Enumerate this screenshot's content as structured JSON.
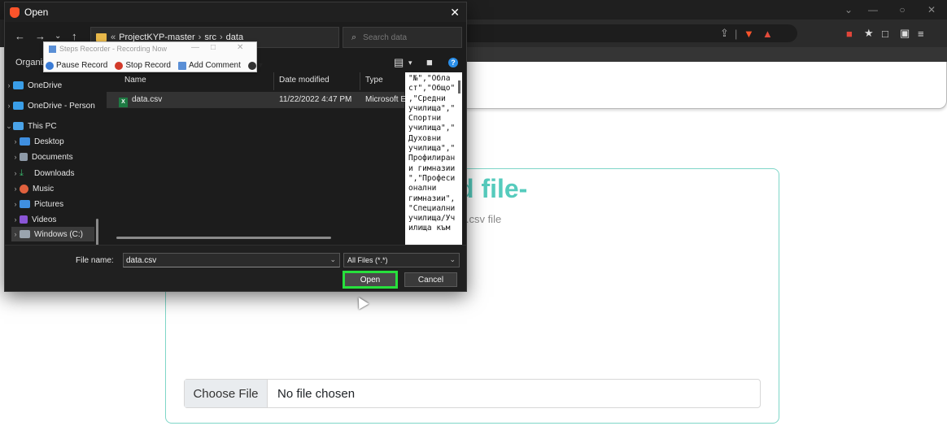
{
  "browser": {
    "window_controls": [
      "⌄",
      "—",
      "○",
      "✕"
    ]
  },
  "page": {
    "upload_title": "d file-",
    "upload_sub": "e .csv file",
    "choose_file_label": "Choose File",
    "no_file_label": "No file chosen",
    "accent_color": "#56cbbd"
  },
  "dialog": {
    "title": "Open",
    "path": [
      "ProjectKYP-master",
      "src",
      "data"
    ],
    "path_prefix": "«",
    "search_placeholder": "Search data",
    "organize_label": "Organize",
    "nav_items": [
      {
        "label": "OneDrive",
        "icon": "cloud-icon",
        "color": "#3a9ee8"
      },
      {
        "label": "OneDrive - Person",
        "icon": "cloud-icon",
        "color": "#3a9ee8"
      },
      {
        "label": "This PC",
        "icon": "computer-icon",
        "color": "#4aa3e8"
      },
      {
        "label": "Desktop",
        "icon": "desktop-folder-icon",
        "color": "#3f8fe0"
      },
      {
        "label": "Documents",
        "icon": "documents-folder-icon",
        "color": "#8e9aa8"
      },
      {
        "label": "Downloads",
        "icon": "downloads-folder-icon",
        "color": "#39b36a"
      },
      {
        "label": "Music",
        "icon": "music-folder-icon",
        "color": "#e0613e"
      },
      {
        "label": "Pictures",
        "icon": "pictures-folder-icon",
        "color": "#3f8fe0"
      },
      {
        "label": "Videos",
        "icon": "videos-folder-icon",
        "color": "#8a55d6"
      },
      {
        "label": "Windows (C:)",
        "icon": "drive-icon",
        "color": "#9aa4ae"
      }
    ],
    "columns": [
      "Name",
      "Date modified",
      "Type"
    ],
    "files": [
      {
        "name": "data.csv",
        "date": "11/22/2022 4:47 PM",
        "type": "Microsoft E"
      }
    ],
    "preview_text": "\"№\",\"Обла\nст\",\"Общо\"\n,\"Средни\nучилища\",\"\nСпортни\nучилища\",\"\nДуховни\nучилища\",\"\nПрофилиран\nи гимназии\n\",\"Професи\nонални\nгимназии\",\n\"Специални\nучилища/Уч\nилища към",
    "file_name_label": "File name:",
    "file_name_value": "data.csv",
    "file_type_value": "All Files (*.*)",
    "open_label": "Open",
    "cancel_label": "Cancel",
    "highlight_color": "#27e03c"
  },
  "steps_recorder": {
    "title": "Steps Recorder - Recording Now",
    "pause_label": "Pause Record",
    "stop_label": "Stop Record",
    "comment_label": "Add Comment"
  }
}
